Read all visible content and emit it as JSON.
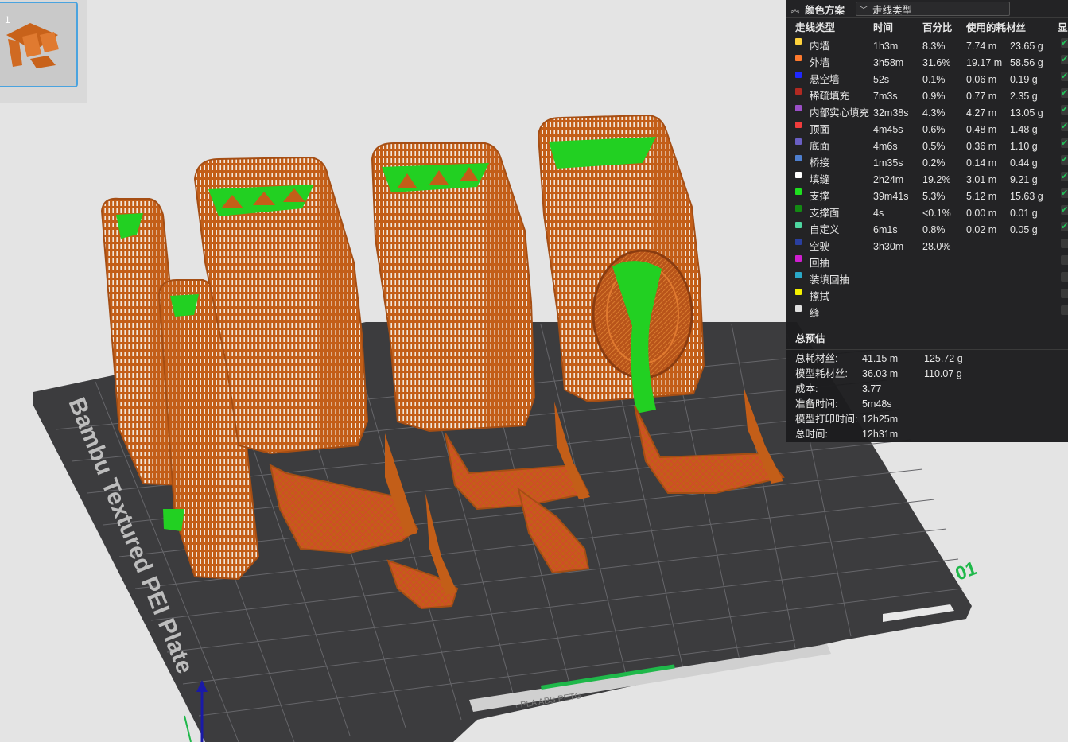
{
  "thumbnail": {
    "index": "1"
  },
  "legend": {
    "collapse_icon": "chevron-up-icon",
    "scheme_label": "颜色方案",
    "scheme_value": "走线类型",
    "headers": {
      "type": "走线类型",
      "time": "时间",
      "percent": "百分比",
      "filament": "使用的耗材丝",
      "visible": "显"
    },
    "rows": [
      {
        "label": "内墙",
        "color": "#ffd23c",
        "time": "1h3m",
        "percent": "8.3%",
        "length": "7.74 m",
        "weight": "23.65 g",
        "visible": true
      },
      {
        "label": "外墙",
        "color": "#ff7a2e",
        "time": "3h58m",
        "percent": "31.6%",
        "length": "19.17 m",
        "weight": "58.56 g",
        "visible": true
      },
      {
        "label": "悬空墙",
        "color": "#1f28ff",
        "time": "52s",
        "percent": "0.1%",
        "length": "0.06 m",
        "weight": "0.19 g",
        "visible": true
      },
      {
        "label": "稀疏填充",
        "color": "#b22a22",
        "time": "7m3s",
        "percent": "0.9%",
        "length": "0.77 m",
        "weight": "2.35 g",
        "visible": true
      },
      {
        "label": "内部实心填充",
        "color": "#9b4fc7",
        "time": "32m38s",
        "percent": "4.3%",
        "length": "4.27 m",
        "weight": "13.05 g",
        "visible": true
      },
      {
        "label": "顶面",
        "color": "#f03c3c",
        "time": "4m45s",
        "percent": "0.6%",
        "length": "0.48 m",
        "weight": "1.48 g",
        "visible": true
      },
      {
        "label": "底面",
        "color": "#6a5fc4",
        "time": "4m6s",
        "percent": "0.5%",
        "length": "0.36 m",
        "weight": "1.10 g",
        "visible": true
      },
      {
        "label": "桥接",
        "color": "#4e7fcf",
        "time": "1m35s",
        "percent": "0.2%",
        "length": "0.14 m",
        "weight": "0.44 g",
        "visible": true
      },
      {
        "label": "填缝",
        "color": "#ffffff",
        "time": "2h24m",
        "percent": "19.2%",
        "length": "3.01 m",
        "weight": "9.21 g",
        "visible": true
      },
      {
        "label": "支撑",
        "color": "#1fe01f",
        "time": "39m41s",
        "percent": "5.3%",
        "length": "5.12 m",
        "weight": "15.63 g",
        "visible": true
      },
      {
        "label": "支撑面",
        "color": "#138a13",
        "time": "4s",
        "percent": "<0.1%",
        "length": "0.00 m",
        "weight": "0.01 g",
        "visible": true
      },
      {
        "label": "自定义",
        "color": "#4ed6a0",
        "time": "6m1s",
        "percent": "0.8%",
        "length": "0.02 m",
        "weight": "0.05 g",
        "visible": true
      },
      {
        "label": "空驶",
        "color": "#2a3fa0",
        "time": "3h30m",
        "percent": "28.0%",
        "length": "",
        "weight": "",
        "visible": false
      },
      {
        "label": "回抽",
        "color": "#d01fd0",
        "time": "",
        "percent": "",
        "length": "",
        "weight": "",
        "visible": false
      },
      {
        "label": "装填回抽",
        "color": "#2aa8c8",
        "time": "",
        "percent": "",
        "length": "",
        "weight": "",
        "visible": false
      },
      {
        "label": "擦拭",
        "color": "#f4f000",
        "time": "",
        "percent": "",
        "length": "",
        "weight": "",
        "visible": false
      },
      {
        "label": "缝",
        "color": "#e0e0e0",
        "time": "",
        "percent": "",
        "length": "",
        "weight": "",
        "visible": false
      }
    ],
    "summary_title": "总预估",
    "summary": [
      {
        "label": "总耗材丝:",
        "v1": "41.15 m",
        "v2": "125.72 g"
      },
      {
        "label": "模型耗材丝:",
        "v1": "36.03 m",
        "v2": "110.07 g"
      },
      {
        "label": "成本:",
        "v1": "3.77",
        "v2": ""
      },
      {
        "label": "准备时间:",
        "v1": "5m48s",
        "v2": ""
      },
      {
        "label": "模型打印时间:",
        "v1": "12h25m",
        "v2": ""
      },
      {
        "label": "总时间:",
        "v1": "12h31m",
        "v2": ""
      }
    ]
  },
  "plate": {
    "name_text": "Bambu Textured PEI Plate",
    "number_text": "01",
    "filament_text": "PLA ABS PETG",
    "colors": {
      "plate": "#3c3c3e",
      "grid": "#6a6a6c",
      "print": "#c8621a",
      "support": "#22d022",
      "accent_green": "#1fb84a"
    }
  }
}
